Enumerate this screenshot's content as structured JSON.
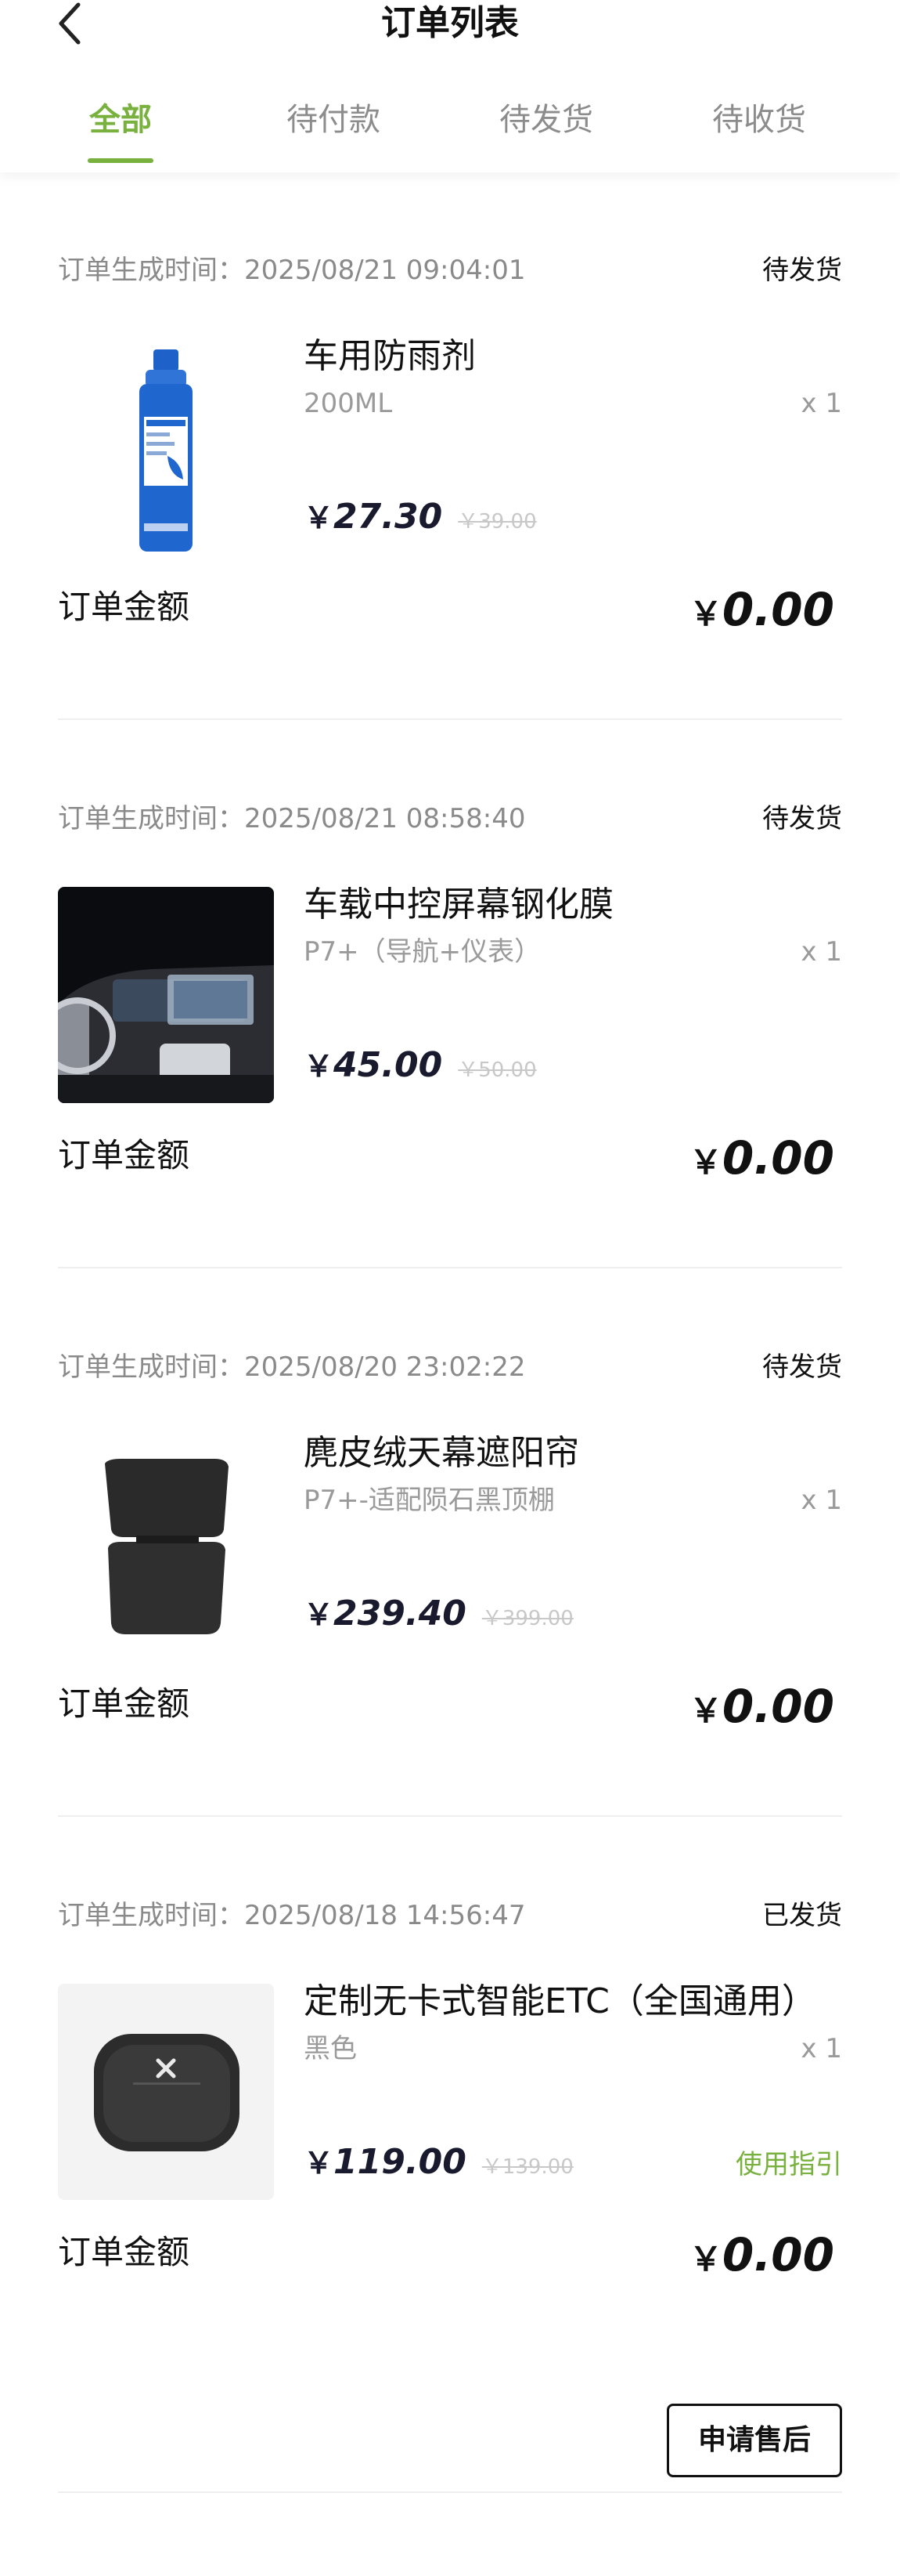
{
  "header": {
    "title": "订单列表",
    "tabs": [
      {
        "label": "全部",
        "active": true
      },
      {
        "label": "待付款",
        "active": false
      },
      {
        "label": "待发货",
        "active": false
      },
      {
        "label": "待收货",
        "active": false
      }
    ]
  },
  "colors": {
    "accent": "#79b13e",
    "price": "#1a1a2e"
  },
  "orders": [
    {
      "time": "订单生成时间：2025/08/21 09:04:01",
      "status": "待发货",
      "product": {
        "name": "车用防雨剂",
        "spec": "200ML",
        "qty": "x 1",
        "currency": "￥",
        "price": "27.30",
        "original_price": "￥39.00",
        "image": "rain-repellent-bottle"
      },
      "amount_label": "订单金额",
      "amount_currency": "￥",
      "amount": "0.00"
    },
    {
      "time": "订单生成时间：2025/08/21 08:58:40",
      "status": "待发货",
      "product": {
        "name": "车载中控屏幕钢化膜",
        "spec": "P7+（导航+仪表）",
        "qty": "x 1",
        "currency": "￥",
        "price": "45.00",
        "original_price": "￥50.00",
        "image": "car-dashboard-screen"
      },
      "amount_label": "订单金额",
      "amount_currency": "￥",
      "amount": "0.00"
    },
    {
      "time": "订单生成时间：2025/08/20 23:02:22",
      "status": "待发货",
      "product": {
        "name": "麂皮绒天幕遮阳帘",
        "spec": "P7+-适配陨石黑顶棚",
        "qty": "x 1",
        "currency": "￥",
        "price": "239.40",
        "original_price": "￥399.00",
        "image": "sunshade-panels"
      },
      "amount_label": "订单金额",
      "amount_currency": "￥",
      "amount": "0.00"
    },
    {
      "time": "订单生成时间：2025/08/18 14:56:47",
      "status": "已发货",
      "product": {
        "name": "定制无卡式智能ETC（全国通用）",
        "spec": "黑色",
        "qty": "x 1",
        "currency": "￥",
        "price": "119.00",
        "original_price": "￥139.00",
        "image": "etc-device"
      },
      "guide_label": "使用指引",
      "amount_label": "订单金额",
      "amount_currency": "￥",
      "amount": "0.00",
      "after_sale_label": "申请售后"
    }
  ]
}
